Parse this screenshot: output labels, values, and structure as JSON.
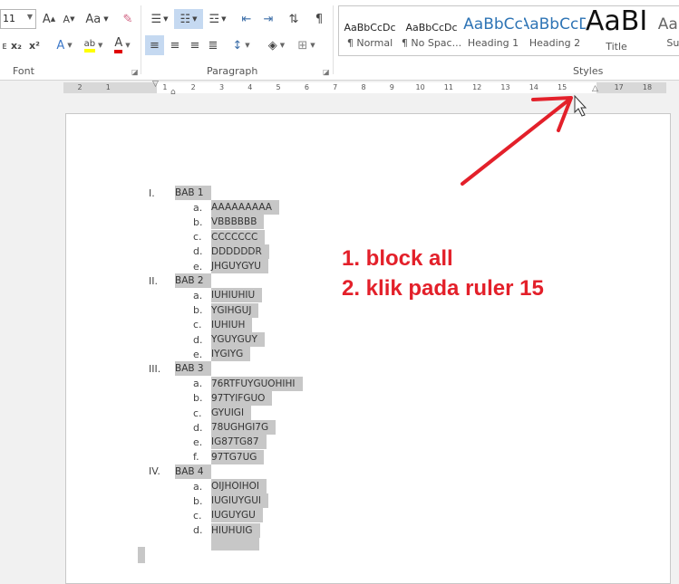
{
  "ribbon": {
    "font_size": "11",
    "font_group_label": "Font",
    "paragraph_group_label": "Paragraph",
    "styles_group_label": "Styles",
    "change_case_label": "Aa",
    "styles": [
      {
        "preview": "AaBbCcDc",
        "name": "¶ Normal",
        "color": "#222"
      },
      {
        "preview": "AaBbCcDc",
        "name": "¶ No Spac...",
        "color": "#222"
      },
      {
        "preview": "AaBbCc",
        "name": "Heading 1",
        "color": "#2e74b5"
      },
      {
        "preview": "AaBbCcD",
        "name": "Heading 2",
        "color": "#2e74b5"
      },
      {
        "preview": "AaBI",
        "name": "Title",
        "color": "#111"
      },
      {
        "preview": "AaBb",
        "name": "Subt",
        "color": "#666"
      }
    ],
    "highlight_color": "#ffff00",
    "font_color": "#e00000"
  },
  "ruler": {
    "ticks": [
      "2",
      "1",
      "",
      "1",
      "2",
      "3",
      "4",
      "5",
      "6",
      "7",
      "8",
      "9",
      "10",
      "11",
      "12",
      "13",
      "14",
      "15",
      "",
      "17",
      "18"
    ]
  },
  "document": {
    "outline": [
      {
        "num": "I.",
        "label": "BAB 1",
        "items": [
          [
            "a.",
            "AAAAAAAAA"
          ],
          [
            "b.",
            "VBBBBBB"
          ],
          [
            "c.",
            "CCCCCCC"
          ],
          [
            "d.",
            "DDDDDDR"
          ],
          [
            "e.",
            "JHGUYGYU"
          ]
        ]
      },
      {
        "num": "II.",
        "label": "BAB 2",
        "items": [
          [
            "a.",
            "IUHIUHIU"
          ],
          [
            "b.",
            "YGIHGUJ"
          ],
          [
            "c.",
            "IUHIUH"
          ],
          [
            "d.",
            "YGUYGUY"
          ],
          [
            "e.",
            "IYGIYG"
          ]
        ]
      },
      {
        "num": "III.",
        "label": "BAB 3",
        "items": [
          [
            "a.",
            "76RTFUYGUOHIHI"
          ],
          [
            "b.",
            "97TYIFGUO"
          ],
          [
            "c.",
            "GYUIGI"
          ],
          [
            "d.",
            "78UGHGI7G"
          ],
          [
            "e.",
            "IG87TG87"
          ],
          [
            "f.",
            "97TG7UG"
          ]
        ]
      },
      {
        "num": "IV.",
        "label": "BAB 4",
        "items": [
          [
            "a.",
            "OIJHOIHOI"
          ],
          [
            "b.",
            "IUGIUYGUI"
          ],
          [
            "c.",
            "IUGUYGU"
          ],
          [
            "d.",
            "HIUHUIG"
          ]
        ]
      }
    ]
  },
  "annotation": {
    "line1": "1. block all",
    "line2": "2. klik pada ruler 15",
    "color": "#e3202a"
  }
}
